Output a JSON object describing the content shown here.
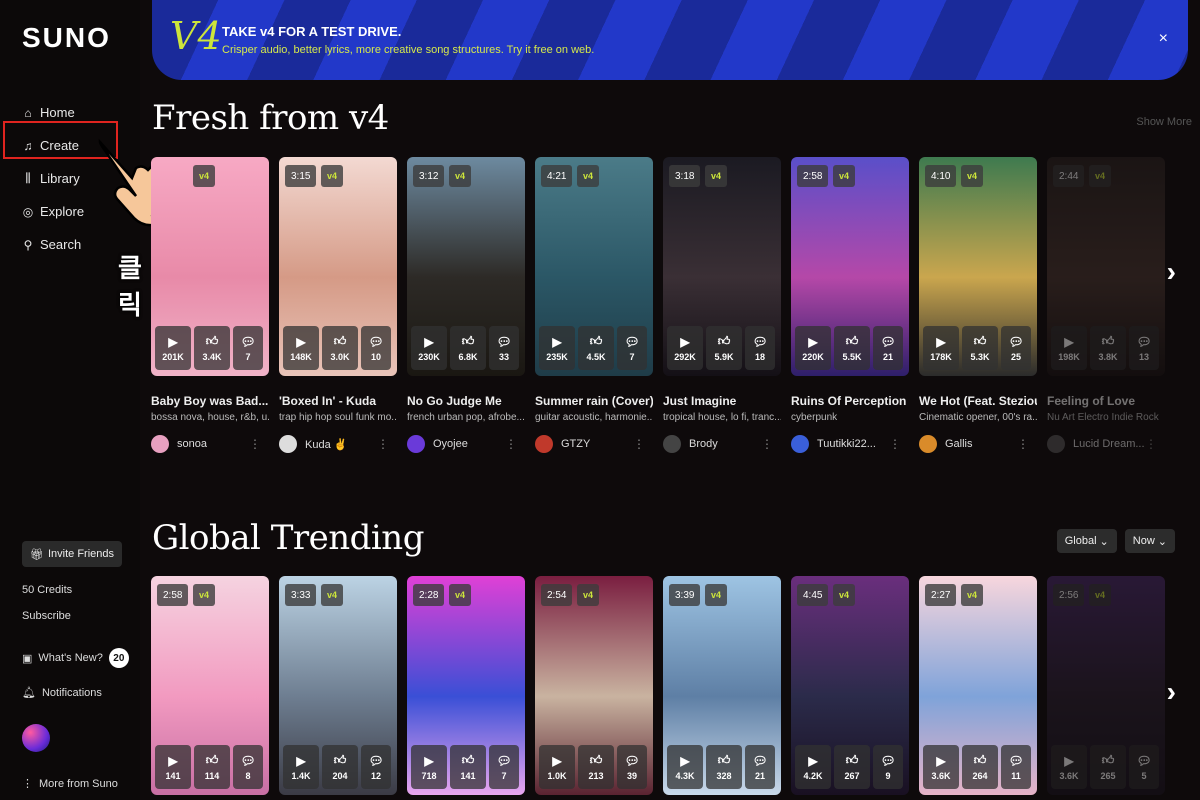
{
  "sidebar": {
    "logo": "SUNO",
    "nav": [
      {
        "label": "Home",
        "icon": "home-icon"
      },
      {
        "label": "Create",
        "icon": "music-note-icon"
      },
      {
        "label": "Library",
        "icon": "library-icon"
      },
      {
        "label": "Explore",
        "icon": "compass-icon"
      },
      {
        "label": "Search",
        "icon": "search-icon"
      }
    ],
    "annotation_text": "클릭",
    "invite_label": "Invite Friends",
    "credits": "50 Credits",
    "subscribe": "Subscribe",
    "whats_new": "What's New?",
    "whats_new_count": "20",
    "notifications": "Notifications",
    "more": "More from Suno"
  },
  "banner": {
    "logo": "V4",
    "title": "TAKE v4 FOR A TEST DRIVE.",
    "subtitle": "Crisper audio, better lyrics, more creative song structures. Try it free on web.",
    "close": "×"
  },
  "fresh": {
    "title": "Fresh from v4",
    "show_more": "Show More",
    "cards": [
      {
        "duration": "",
        "version": "v4",
        "plays": "201K",
        "likes": "3.4K",
        "comments": "7",
        "title": "Baby Boy was Bad...",
        "tags": "bossa nova, house, r&b, u...",
        "artist": "sonoa"
      },
      {
        "duration": "3:15",
        "version": "v4",
        "plays": "148K",
        "likes": "3.0K",
        "comments": "10",
        "title": "'Boxed In' - Kuda",
        "tags": "trap hip hop soul funk mo...",
        "artist": "Kuda ✌"
      },
      {
        "duration": "3:12",
        "version": "v4",
        "plays": "230K",
        "likes": "6.8K",
        "comments": "33",
        "title": "No Go Judge Me",
        "tags": "french urban pop, afrobe...",
        "artist": "Oyojee"
      },
      {
        "duration": "4:21",
        "version": "v4",
        "plays": "235K",
        "likes": "4.5K",
        "comments": "7",
        "title": "Summer rain (Cover)...",
        "tags": "guitar acoustic, harmonie...",
        "artist": "GTZY"
      },
      {
        "duration": "3:18",
        "version": "v4",
        "plays": "292K",
        "likes": "5.9K",
        "comments": "18",
        "title": "Just Imagine",
        "tags": "tropical house, lo fi, tranc...",
        "artist": "Brody"
      },
      {
        "duration": "2:58",
        "version": "v4",
        "plays": "220K",
        "likes": "5.5K",
        "comments": "21",
        "title": "Ruins Of Perception",
        "tags": "cyberpunk",
        "artist": "Tuutikki22..."
      },
      {
        "duration": "4:10",
        "version": "v4",
        "plays": "178K",
        "likes": "5.3K",
        "comments": "25",
        "title": "We Hot (Feat. Stezious)",
        "tags": "Cinematic opener, 00's ra...",
        "artist": "Gallis"
      },
      {
        "duration": "2:44",
        "version": "v4",
        "plays": "198K",
        "likes": "3.8K",
        "comments": "13",
        "title": "Feeling of Love",
        "tags": "Nu Art Electro Indie Rock",
        "artist": "Lucid Dream..."
      }
    ]
  },
  "trending": {
    "title": "Global Trending",
    "filter_region": "Global",
    "filter_time": "Now",
    "cards": [
      {
        "duration": "2:58",
        "version": "v4",
        "plays": "141",
        "likes": "114",
        "comments": "8"
      },
      {
        "duration": "3:33",
        "version": "v4",
        "plays": "1.4K",
        "likes": "204",
        "comments": "12"
      },
      {
        "duration": "2:28",
        "version": "v4",
        "plays": "718",
        "likes": "141",
        "comments": "7"
      },
      {
        "duration": "2:54",
        "version": "v4",
        "plays": "1.0K",
        "likes": "213",
        "comments": "39"
      },
      {
        "duration": "3:39",
        "version": "v4",
        "plays": "4.3K",
        "likes": "328",
        "comments": "21"
      },
      {
        "duration": "4:45",
        "version": "v4",
        "plays": "4.2K",
        "likes": "267",
        "comments": "9"
      },
      {
        "duration": "2:27",
        "version": "v4",
        "plays": "3.6K",
        "likes": "264",
        "comments": "11"
      },
      {
        "duration": "2:56",
        "version": "v4",
        "plays": "3.6K",
        "likes": "265",
        "comments": "5"
      }
    ]
  },
  "colors": {
    "background": "#0e0a0b",
    "accent_lime": "#cde53b",
    "banner_blue": "#2238c9",
    "highlight_red": "#e0241f"
  }
}
